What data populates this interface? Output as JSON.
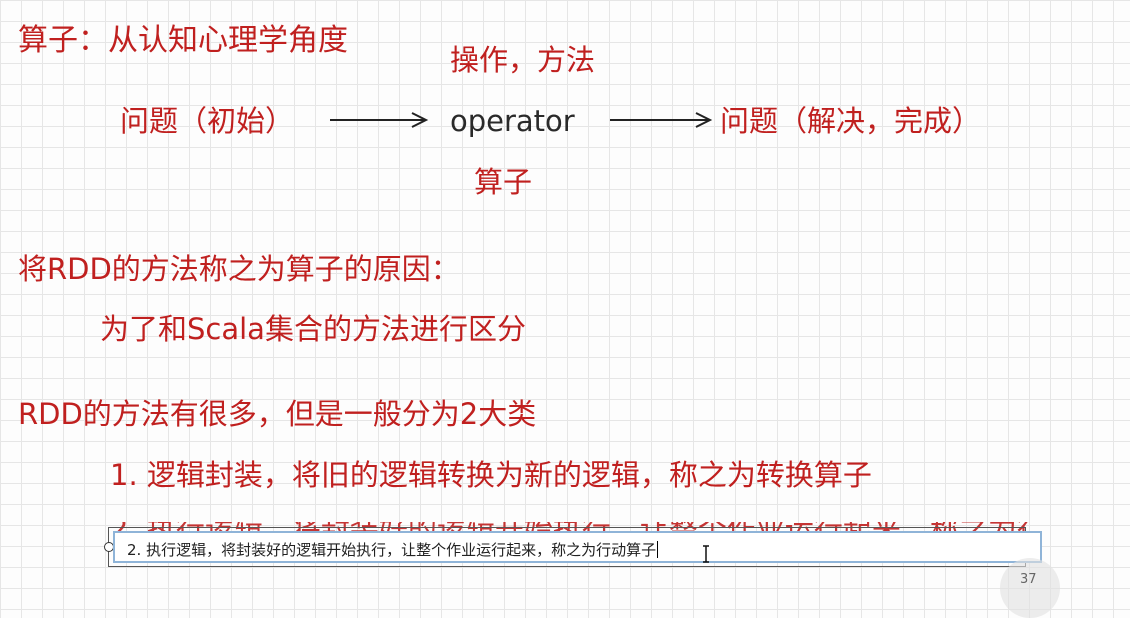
{
  "slide": {
    "title": "算子：从认知心理学角度",
    "operation_label": "操作，方法",
    "problem_start": "问题（初始）",
    "operator": "operator",
    "problem_end": "问题（解决，完成）",
    "operator_cn": "算子",
    "reason_heading": "将RDD的方法称之为算子的原因：",
    "reason_text": "为了和Scala集合的方法进行区分",
    "types_heading": "RDD的方法有很多，但是一般分为2大类",
    "type1": "1. 逻辑封装，将旧的逻辑转换为新的逻辑，称之为转换算子",
    "type2_overlapped": "2. 执行逻辑，将封装好的逻辑开始执行，让整个作业运行起来，称之为行动算子"
  },
  "editor": {
    "text_value": "2. 执行逻辑，将封装好的逻辑开始执行，让整个作业运行起来，称之为行动算子"
  },
  "page_number": "37",
  "colors": {
    "accent_red": "#c0201f",
    "text_dark": "#2a2a2a",
    "grid": "#e6e6e6",
    "edit_border": "#8fb4d8"
  }
}
